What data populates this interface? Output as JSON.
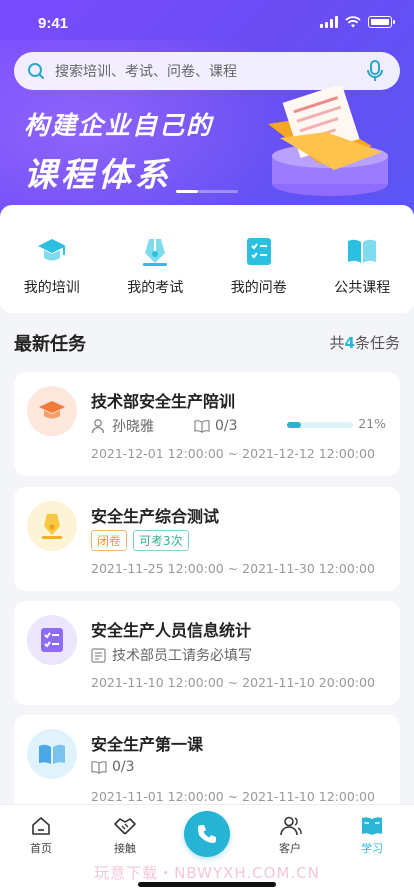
{
  "status": {
    "time": "9:41"
  },
  "search": {
    "placeholder": "搜索培训、考试、问卷、课程"
  },
  "banner": {
    "line1": "构建企业自己的",
    "line2": "课程体系"
  },
  "quick_menu": [
    {
      "label": "我的培训",
      "icon": "graduation-cap-icon"
    },
    {
      "label": "我的考试",
      "icon": "pen-icon"
    },
    {
      "label": "我的问卷",
      "icon": "checklist-icon"
    },
    {
      "label": "公共课程",
      "icon": "open-book-icon"
    }
  ],
  "tasks": {
    "title": "最新任务",
    "count_prefix": "共",
    "count": "4",
    "count_suffix": "条任务",
    "items": [
      {
        "title": "技术部安全生产陪训",
        "person": "孙晓雅",
        "lessons": "0/3",
        "progress": 21,
        "progress_text": "21%",
        "date": "2021-12-01 12:00:00 ~ 2021-12-12 12:00:00",
        "icon": "graduation-cap-icon"
      },
      {
        "title": "安全生产综合测试",
        "tag1": "闭卷",
        "tag2": "可考3次",
        "date": "2021-11-25 12:00:00 ~ 2021-11-30 12:00:00",
        "icon": "pen-icon"
      },
      {
        "title": "安全生产人员信息统计",
        "note": "技术部员工请务必填写",
        "date": "2021-11-10 12:00:00 ~ 2021-11-10 20:00:00",
        "icon": "checklist-icon"
      },
      {
        "title": "安全生产第一课",
        "lessons": "0/3",
        "date": "2021-11-01 12:00:00 ~ 2021-11-10 12:00:00",
        "icon": "open-book-icon"
      }
    ]
  },
  "tabbar": [
    {
      "label": "首页",
      "icon": "home-icon"
    },
    {
      "label": "接触",
      "icon": "handshake-icon"
    },
    {
      "label": "",
      "icon": "phone-icon"
    },
    {
      "label": "客户",
      "icon": "users-icon"
    },
    {
      "label": "学习",
      "icon": "book-icon"
    }
  ],
  "watermark": "玩意下载・NBWYXH.COM.CN",
  "colors": {
    "primary": "#6a4cf3",
    "accent": "#2bb6d6"
  }
}
